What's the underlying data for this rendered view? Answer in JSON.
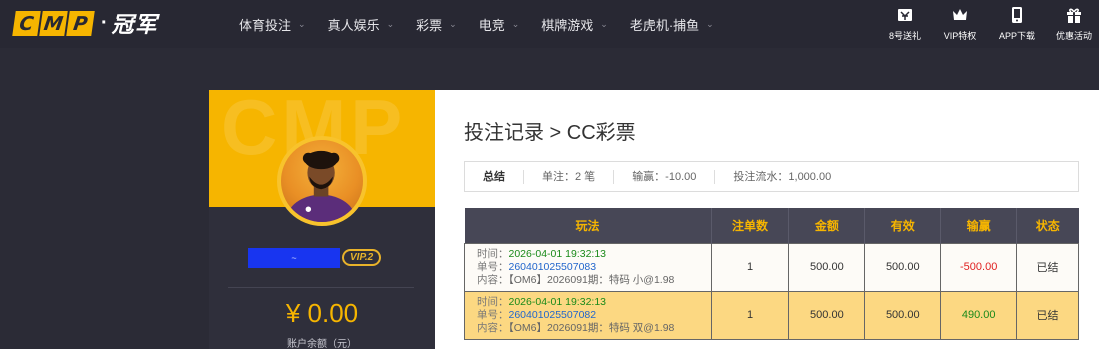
{
  "header": {
    "logo_letters": [
      "C",
      "M",
      "P"
    ],
    "logo_sep": "·",
    "logo_cn": "冠军",
    "nav": [
      {
        "label": "体育投注"
      },
      {
        "label": "真人娱乐"
      },
      {
        "label": "彩票"
      },
      {
        "label": "电竞"
      },
      {
        "label": "棋牌游戏"
      },
      {
        "label": "老虎机·捕鱼"
      }
    ],
    "quick_links": [
      {
        "label": "8号送礼",
        "icon": "gift-box-icon"
      },
      {
        "label": "VIP特权",
        "icon": "crown-icon"
      },
      {
        "label": "APP下载",
        "icon": "mobile-phone-icon"
      },
      {
        "label": "优惠活动",
        "icon": "gift-icon"
      }
    ]
  },
  "profile": {
    "bg_text": "CMP",
    "username": "~",
    "vip_badge": "VIP.2",
    "balance": "¥ 0.00",
    "balance_label": "账户余额（元）"
  },
  "main": {
    "breadcrumb": "投注记录 > CC彩票",
    "summary": {
      "total_label": "总结",
      "bets": "单注：2 笔",
      "win_loss": "输赢：-10.00",
      "turnover": "投注流水：1,000.00"
    },
    "table": {
      "headers": [
        "玩法",
        "注单数",
        "金额",
        "有效",
        "输赢",
        "状态"
      ],
      "rows": [
        {
          "time_label": "时间：",
          "time": "2026-04-01 19:32:13",
          "order_label": "单号：",
          "order": "260401025507083",
          "content_label": "内容：",
          "content": "【OM6】2026091期：特码 小@1.98",
          "count": "1",
          "amount": "500.00",
          "valid": "500.00",
          "win_loss": "-500.00",
          "status": "已结"
        },
        {
          "time_label": "时间：",
          "time": "2026-04-01 19:32:13",
          "order_label": "单号：",
          "order": "260401025507082",
          "content_label": "内容：",
          "content": "【OM6】2026091期：特码 双@1.98",
          "count": "1",
          "amount": "500.00",
          "valid": "500.00",
          "win_loss": "490.00",
          "status": "已结"
        }
      ]
    }
  },
  "colors": {
    "accent": "#f6b500",
    "nav_bg": "#282833",
    "loss": "#e02020",
    "win": "#1a8a1a",
    "link": "#2266cc"
  }
}
